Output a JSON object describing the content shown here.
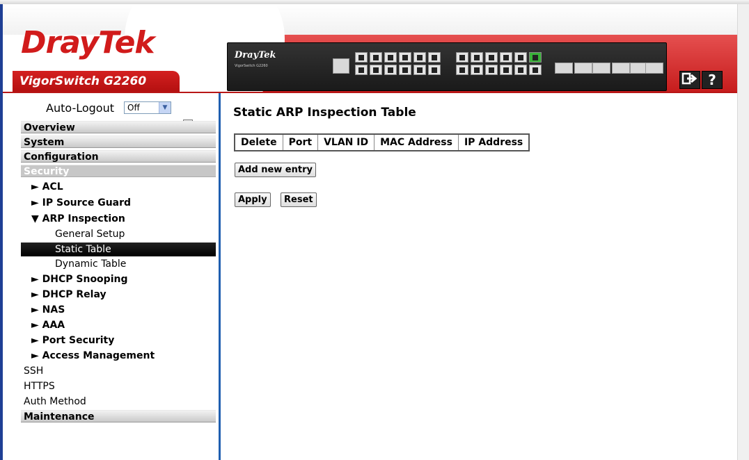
{
  "header": {
    "logo_part1": "Dray",
    "logo_part2": "Tek",
    "model": "VigorSwitch G2260",
    "device_logo": "DrayTek",
    "device_sub": "VigorSwitch G2260",
    "logout_icon": "logout-icon",
    "help_label": "?"
  },
  "sidebar": {
    "autologout_label": "Auto-Logout",
    "autologout_value": "Off",
    "sections": {
      "overview": "Overview",
      "system": "System",
      "configuration": "Configuration",
      "security": "Security",
      "maintenance": "Maintenance"
    },
    "security_items": {
      "acl": "► ACL",
      "ip_source_guard": "► IP Source Guard",
      "arp_inspection": "▼ ARP Inspection",
      "general_setup": "General Setup",
      "static_table": "Static Table",
      "dynamic_table": "Dynamic Table",
      "dhcp_snooping": "► DHCP Snooping",
      "dhcp_relay": "► DHCP Relay",
      "nas": "► NAS",
      "aaa": "► AAA",
      "port_security": "► Port Security",
      "access_management": "► Access Management",
      "ssh": "SSH",
      "https": "HTTPS",
      "auth_method": "Auth Method"
    }
  },
  "main": {
    "title": "Static ARP Inspection Table",
    "columns": [
      "Delete",
      "Port",
      "VLAN ID",
      "MAC Address",
      "IP Address"
    ],
    "add_button": "Add new entry",
    "apply_button": "Apply",
    "reset_button": "Reset"
  },
  "colors": {
    "brand_red": "#d11b1b",
    "sidebar_selected": "#000000",
    "separator_blue": "#1f5fb0"
  }
}
